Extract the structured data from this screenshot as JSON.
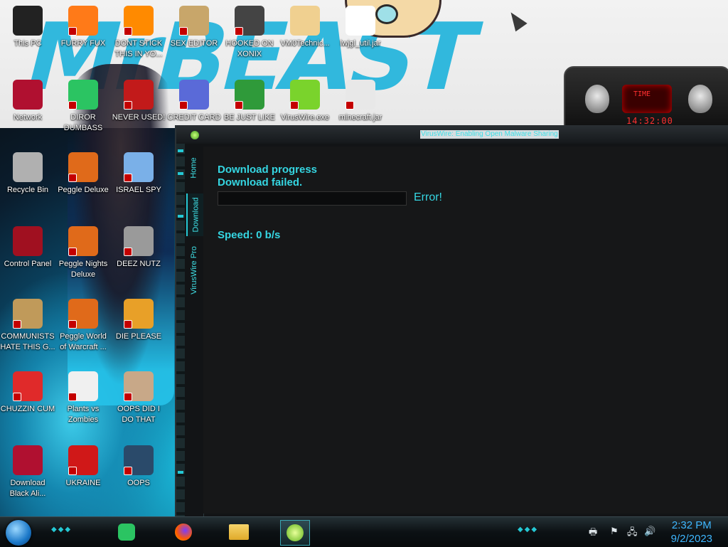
{
  "desktop": {
    "icons": [
      {
        "label": "This PC",
        "icon": "computer-icon",
        "color": "#222"
      },
      {
        "label": "FURRY FUX",
        "icon": "firefox-icon",
        "color": "#ff7a18"
      },
      {
        "label": "DONT STICK THIS IN YO...",
        "icon": "vlc-cone-icon",
        "color": "#ff8a00"
      },
      {
        "label": "SEX EDITOR",
        "icon": "hxd-icon",
        "color": "#c8a66a"
      },
      {
        "label": "HOOKED ON XONIX",
        "icon": "xonix-icon",
        "color": "#444"
      },
      {
        "label": "VM0Technic...",
        "icon": "person-icon",
        "color": "#f0d090"
      },
      {
        "label": "lwjgl_util.jar",
        "icon": "jar-icon",
        "color": "#ffffff"
      },
      {
        "label": "Network",
        "icon": "alienware-icon",
        "color": "#b01030"
      },
      {
        "label": "DIROR DUMBASS",
        "icon": "notes-icon",
        "color": "#2bc462"
      },
      {
        "label": "NEVER USED!",
        "icon": "devcpp-icon",
        "color": "#c21a1a"
      },
      {
        "label": "CREDIT CARD",
        "icon": "credit-card-icon",
        "color": "#5a6ad8"
      },
      {
        "label": "BE JUST LIKE",
        "icon": "santa-icon",
        "color": "#2f9a3a"
      },
      {
        "label": "VirusWire.exe",
        "icon": "lime-icon",
        "color": "#7ad32c"
      },
      {
        "label": "minecraft.jar",
        "icon": "java-icon",
        "color": "#e8e8e8"
      },
      {
        "label": "Recycle Bin",
        "icon": "recycle-bin-icon",
        "color": "#b0b0b0"
      },
      {
        "label": "Peggle Deluxe",
        "icon": "peggle-icon",
        "color": "#e06a1a"
      },
      {
        "label": "ISRAEL SPY",
        "icon": "glass-icon",
        "color": "#7ab0e8"
      },
      {
        "label": "Control Panel",
        "icon": "control-panel-icon",
        "color": "#a01020"
      },
      {
        "label": "Peggle Nights Deluxe",
        "icon": "peggle-icon",
        "color": "#e06a1a"
      },
      {
        "label": "DEEZ NUTZ",
        "icon": "windows-stack-icon",
        "color": "#9a9a9a"
      },
      {
        "label": "COMMUNISTS HATE THIS G...",
        "icon": "money-bag-icon",
        "color": "#c09a5a"
      },
      {
        "label": "Peggle World of Warcraft ...",
        "icon": "peggle-icon",
        "color": "#e06a1a"
      },
      {
        "label": "DIE PLEASE",
        "icon": "de-icon",
        "color": "#e8a028"
      },
      {
        "label": "CHUZZIN CUM",
        "icon": "chuzzle-icon",
        "color": "#e02a2a"
      },
      {
        "label": "Plants vs Zombies",
        "icon": "flower-icon",
        "color": "#f0f0f0"
      },
      {
        "label": "OOPS DID I DO THAT",
        "icon": "portrait-icon",
        "color": "#c8a888"
      },
      {
        "label": "Download Black Ali...",
        "icon": "alienware-icon",
        "color": "#b01030"
      },
      {
        "label": "UKRAINE",
        "icon": "radiation-icon",
        "color": "#d01818"
      },
      {
        "label": "OOPS",
        "icon": "portrait-frame-icon",
        "color": "#2a4a6a"
      }
    ],
    "wallpaper_text": "MrBEAST",
    "widget": {
      "label": "TIME",
      "clock": "14:32:00"
    }
  },
  "window": {
    "title": "VirusWire: Enabling Open Malware Sharing",
    "nav": [
      "Home",
      "Download",
      "VirusWire Pro"
    ],
    "active_nav": "Download",
    "download_progress_label": "Download progress",
    "status": "Download failed.",
    "progress_fraction": 0,
    "error": "Error!",
    "speed": "Speed: 0 b/s"
  },
  "taskbar": {
    "apps": [
      "notes-icon",
      "firefox-icon",
      "file-explorer-icon",
      "lime-icon"
    ],
    "active_app": "lime-icon",
    "tray_icons": [
      "printer-icon",
      "flag-icon",
      "network-icon",
      "volume-icon"
    ],
    "time": "2:32 PM",
    "date": "9/2/2023",
    "accent": "#25c8d4"
  }
}
